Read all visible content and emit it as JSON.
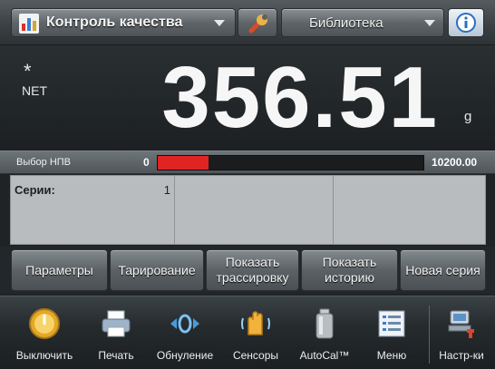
{
  "header": {
    "app_title": "Контроль качества",
    "library_label": "Библиотека",
    "app_icon": "bar-chart-icon",
    "tools_icon": "wrench-icon",
    "info_icon": "info-icon"
  },
  "display": {
    "indicator": "*",
    "net_label": "NET",
    "weight": "356.51",
    "unit": "g"
  },
  "capacity_bar": {
    "label": "Выбор НПВ",
    "min": "0",
    "max": "10200.00",
    "fill_fraction": 0.19,
    "fill_color": "#e02424"
  },
  "info_panel": {
    "series_label": "Серии:",
    "series_value": "1"
  },
  "actions": [
    {
      "label": "Параметры"
    },
    {
      "label": "Тарирование"
    },
    {
      "label": "Показать трассировку"
    },
    {
      "label": "Показать историю"
    },
    {
      "label": "Новая серия"
    }
  ],
  "dock": [
    {
      "label": "Выключить",
      "icon": "power-icon"
    },
    {
      "label": "Печать",
      "icon": "printer-icon"
    },
    {
      "label": "Обнуление",
      "icon": "zero-icon"
    },
    {
      "label": "Сенсоры",
      "icon": "hand-sensor-icon"
    },
    {
      "label": "AutoCal™",
      "icon": "autocal-weight-icon"
    },
    {
      "label": "Меню",
      "icon": "menu-list-icon"
    },
    {
      "label": "Настр-ки",
      "icon": "settings-icon"
    }
  ]
}
